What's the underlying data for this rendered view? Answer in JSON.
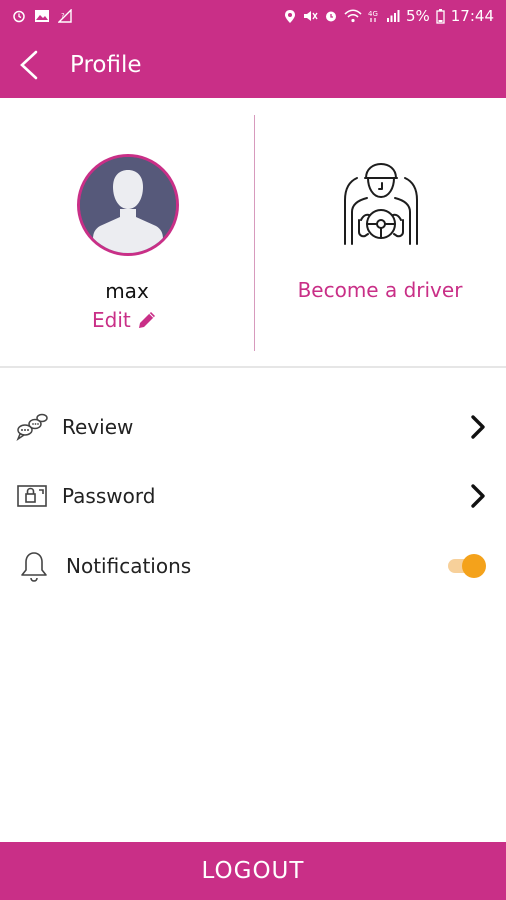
{
  "status_bar": {
    "left_icons": [
      "alarm-icon",
      "image-icon",
      "no-signal-icon"
    ],
    "right_icons": [
      "location-icon",
      "mute-icon",
      "alarm-clock-icon",
      "wifi-icon",
      "network-4g-icon",
      "signal-icon",
      "battery-icon"
    ],
    "battery_percent": "5%",
    "time": "17:44"
  },
  "app_bar": {
    "back_icon": "back-arrow-icon",
    "title": "Profile"
  },
  "profile": {
    "username": "max",
    "edit_label": "Edit",
    "edit_icon": "pencil-icon",
    "avatar_icon": "user-silhouette-icon",
    "driver_icon": "driver-steering-wheel-icon",
    "become_driver_label": "Become a driver"
  },
  "menu": {
    "review_label": "Review",
    "review_icon": "chat-bubbles-icon",
    "password_label": "Password",
    "password_icon": "lock-card-icon",
    "notifications_label": "Notifications",
    "notifications_icon": "bell-icon",
    "notifications_enabled": true
  },
  "logout_label": "LOGOUT",
  "colors": {
    "brand": "#c92f87",
    "toggle_on": "#f4a21b",
    "avatar_bg": "#56597a"
  }
}
